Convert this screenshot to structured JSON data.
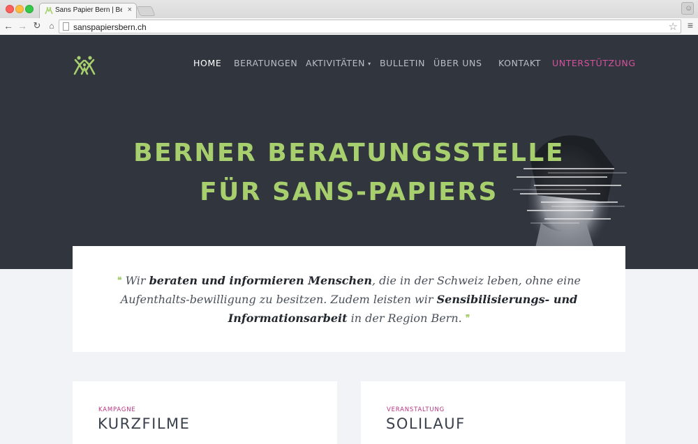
{
  "browser": {
    "tab_title": "Sans Papier Bern | Beratung",
    "tab_close": "×",
    "url": "sanspapiersbern.ch"
  },
  "nav": {
    "items": [
      {
        "label": "HOME"
      },
      {
        "label": "BERATUNGEN"
      },
      {
        "label": "AKTIVITÄTEN"
      },
      {
        "label": "BULLETIN"
      },
      {
        "label": "ÜBER UNS"
      },
      {
        "label": "KONTAKT"
      },
      {
        "label": "UNTERSTÜTZUNG"
      }
    ],
    "dropdown_caret": "▾"
  },
  "hero": {
    "title_line1": "BERNER BERATUNGSSTELLE",
    "title_line2": "FÜR SANS-PAPIERS"
  },
  "intro": {
    "open_quote": "❝",
    "part1": "Wir ",
    "bold1": "beraten und informieren Menschen",
    "part2": ", die in der Schweiz leben, ohne eine Aufenthalts-bewilligung zu besitzen. Zudem leisten wir ",
    "bold2": "Sensibilisierungs- und Informationsarbeit",
    "part3": " in der Region Bern. ",
    "close_quote": "❞"
  },
  "cards": [
    {
      "kicker": "KAMPAGNE",
      "title": "KURZFILME"
    },
    {
      "kicker": "VERANSTALTUNG",
      "title": "SOLILAUF"
    }
  ],
  "colors": {
    "hero_bg": "#30353e",
    "accent_green": "#a8cf6e",
    "accent_pink": "#d6529e",
    "page_bg": "#f2f3f6"
  }
}
